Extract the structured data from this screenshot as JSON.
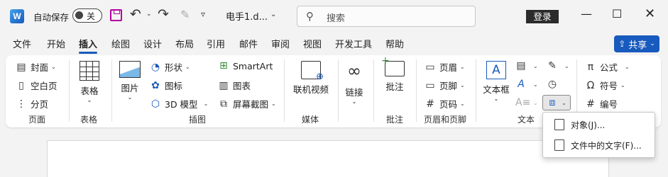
{
  "titlebar": {
    "app_logo": "W",
    "autosave_label": "自动保存",
    "autosave_state": "关",
    "doc_title": "电手1.d...",
    "search_placeholder": "搜索",
    "login_label": "登录",
    "icons": [
      "word-icon",
      "save-icon",
      "undo-icon",
      "redo-icon",
      "format-painter-icon",
      "customize-qat-icon",
      "search-icon",
      "minimize-icon",
      "maximize-icon",
      "close-icon"
    ]
  },
  "tabs": [
    "文件",
    "开始",
    "插入",
    "绘图",
    "设计",
    "布局",
    "引用",
    "邮件",
    "审阅",
    "视图",
    "开发工具",
    "帮助"
  ],
  "active_tab": "插入",
  "share_label": "共享",
  "ribbon": {
    "pages": {
      "cover": "封面",
      "blank": "空白页",
      "break": "分页",
      "label": "页面"
    },
    "tables": {
      "table": "表格",
      "label": "表格"
    },
    "illustrations": {
      "pictures": "图片",
      "shapes": "形状",
      "icons": "图标",
      "models": "3D 模型",
      "smartart": "SmartArt",
      "chart": "图表",
      "screenshot": "屏幕截图",
      "label": "插图"
    },
    "media": {
      "online_video": "联机视频",
      "label": "媒体"
    },
    "links": {
      "link": "链接"
    },
    "comments": {
      "comment": "批注",
      "label": "批注"
    },
    "header_footer": {
      "header": "页眉",
      "footer": "页脚",
      "page_number": "页码",
      "label": "页眉和页脚"
    },
    "text": {
      "textbox": "文本框",
      "label": "文本"
    },
    "symbols": {
      "equation": "公式",
      "symbol": "符号",
      "number": "编号"
    }
  },
  "object_menu": {
    "items": [
      "对象(J)...",
      "文件中的文字(F)..."
    ]
  },
  "colors": {
    "accent": "#185abd",
    "save": "#b4009e"
  }
}
